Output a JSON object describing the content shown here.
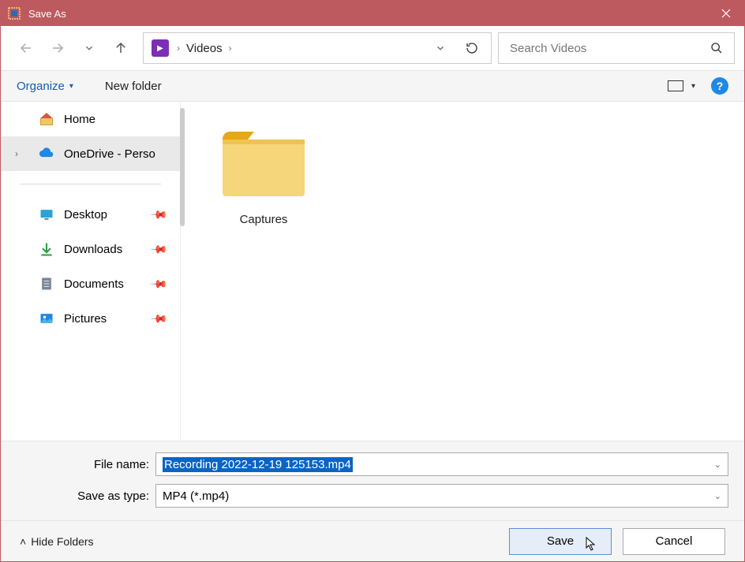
{
  "window": {
    "title": "Save As"
  },
  "breadcrumb": {
    "item": "Videos"
  },
  "search": {
    "placeholder": "Search Videos"
  },
  "toolbar": {
    "organize": "Organize",
    "newfolder": "New folder",
    "help": "?"
  },
  "sidebar": {
    "home": "Home",
    "onedrive": "OneDrive - Perso",
    "desktop": "Desktop",
    "downloads": "Downloads",
    "documents": "Documents",
    "pictures": "Pictures"
  },
  "content": {
    "folder1": "Captures"
  },
  "fields": {
    "filename_label": "File name:",
    "filename_value": "Recording 2022-12-19 125153.mp4",
    "type_label": "Save as type:",
    "type_value": "MP4 (*.mp4)"
  },
  "footer": {
    "hide": "Hide Folders",
    "save": "Save",
    "cancel": "Cancel"
  }
}
